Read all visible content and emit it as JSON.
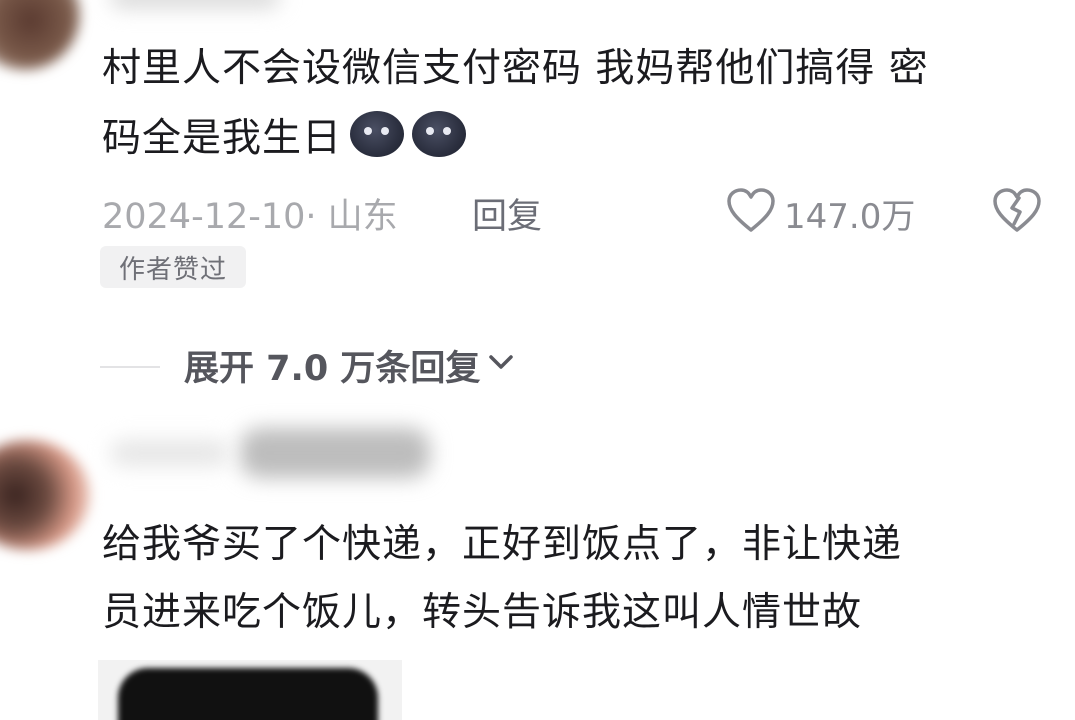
{
  "comments": [
    {
      "text_line1": "村里人不会设微信支付密码 我妈帮他们搞得 密",
      "text_line2": "码全是我生日",
      "emoji_icons": [
        "new-moon-face-icon",
        "new-moon-face-icon"
      ],
      "date_location": "2024-12-10· 山东",
      "reply_label": "回复",
      "like_count": "147.0万",
      "author_liked_badge": "作者赞过",
      "expand_label": "展开 7.0 万条回复"
    },
    {
      "text_line1": "给我爷买了个快递，正好到饭点了，非让快递",
      "text_line2": "员进来吃个饭儿，转头告诉我这叫人情世故"
    }
  ]
}
